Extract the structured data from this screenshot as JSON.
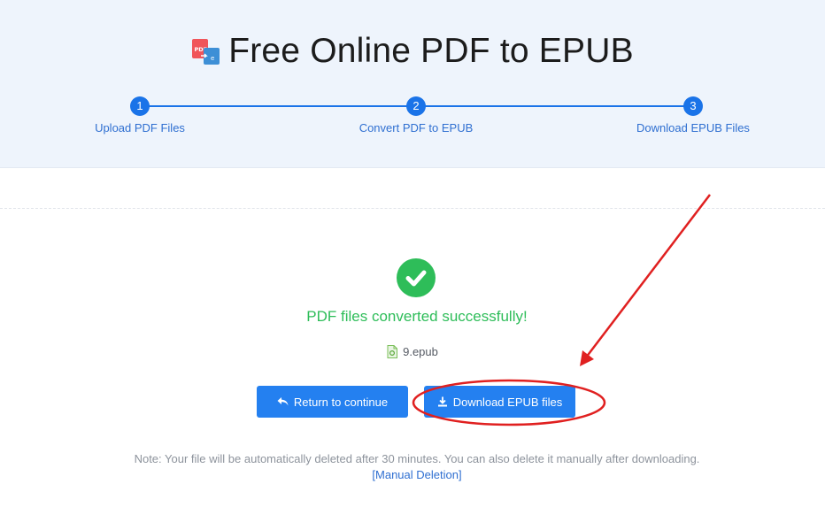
{
  "header": {
    "title": "Free Online PDF to EPUB",
    "logo_icon": "pdf-to-epub-logo-icon"
  },
  "steps": [
    {
      "number": "1",
      "label": "Upload PDF Files"
    },
    {
      "number": "2",
      "label": "Convert PDF to EPUB"
    },
    {
      "number": "3",
      "label": "Download EPUB Files"
    }
  ],
  "result": {
    "success_icon": "check-circle-icon",
    "message": "PDF files converted successfully!",
    "file_icon": "epub-file-icon",
    "file_name": "9.epub"
  },
  "buttons": {
    "return_label": "Return to continue",
    "return_icon": "reply-arrow-icon",
    "download_label": "Download EPUB files",
    "download_icon": "download-icon"
  },
  "note": {
    "text": "Note: Your file will be automatically deleted after 30 minutes. You can also delete it manually after downloading.",
    "link": "[Manual Deletion]"
  },
  "colors": {
    "accent": "#1a73e8",
    "success": "#2ebd59",
    "annotation": "#e02020"
  }
}
